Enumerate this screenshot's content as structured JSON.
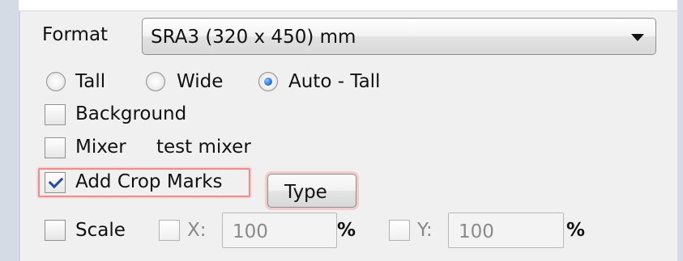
{
  "format": {
    "label": "Format",
    "selected_value": "SRA3 (320 x 450) mm"
  },
  "orientation": {
    "options": [
      {
        "label": "Tall",
        "checked": false
      },
      {
        "label": "Wide",
        "checked": false
      },
      {
        "label": "Auto - Tall",
        "checked": true
      }
    ]
  },
  "options": {
    "background": {
      "label": "Background",
      "checked": false
    },
    "mixer": {
      "label": "Mixer",
      "value": "test mixer",
      "checked": false
    },
    "crop_marks": {
      "label": "Add Crop Marks",
      "checked": true
    },
    "type_button_label": "Type"
  },
  "scale": {
    "label": "Scale",
    "checked": false,
    "x_label": "X:",
    "x_value": "100",
    "y_label": "Y:",
    "y_value": "100",
    "unit": "%"
  },
  "colors": {
    "highlight": "#f18b8b",
    "radio_selected": "#2b7be0",
    "checkbox_check": "#1e4aa8"
  },
  "icons": {
    "dropdown": "chevron-down-icon",
    "checkmark": "checkmark-icon"
  }
}
